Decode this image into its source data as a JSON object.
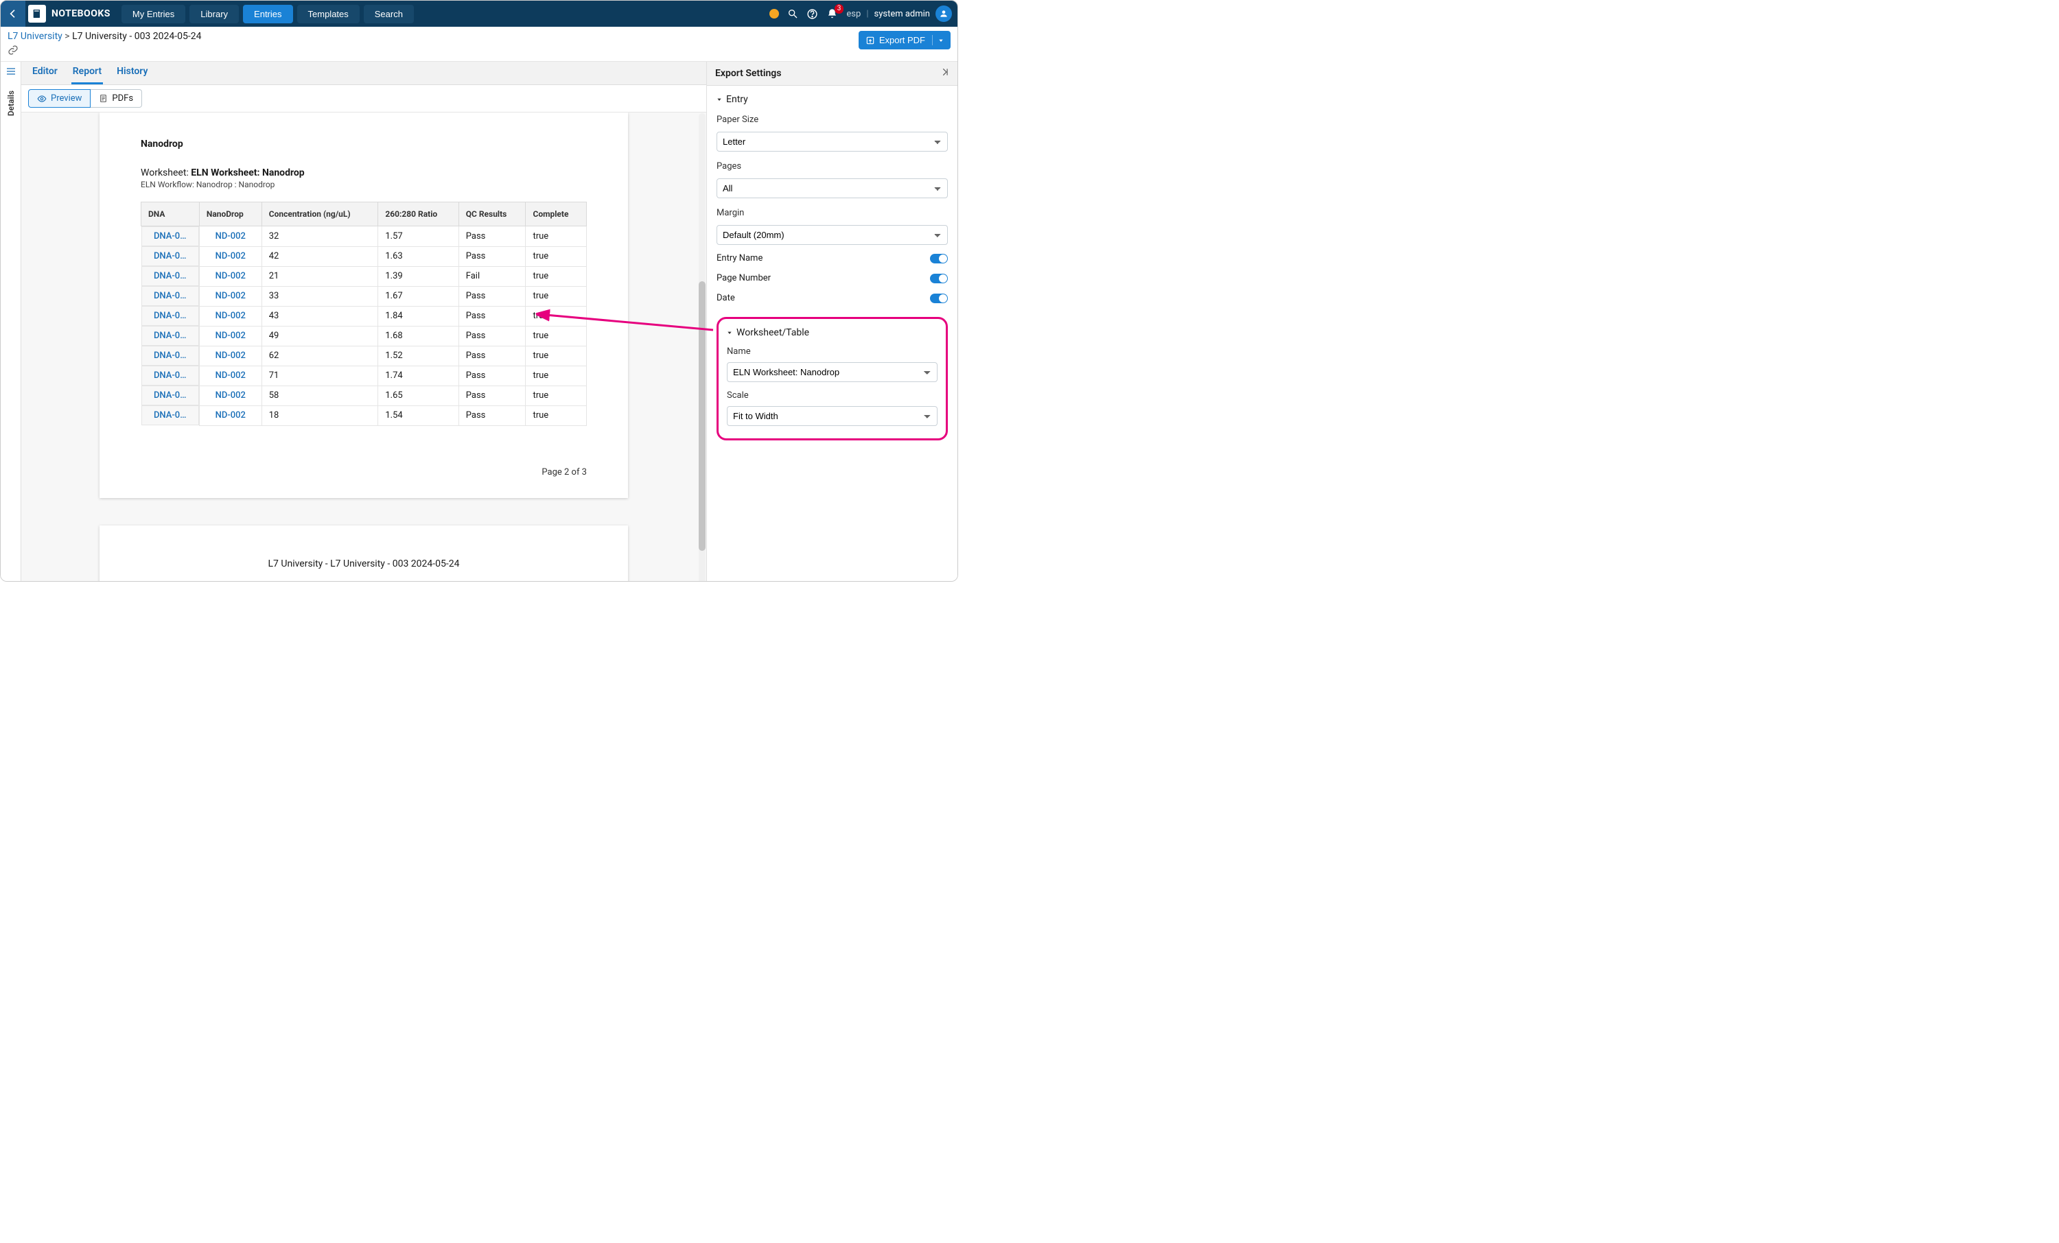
{
  "topbar": {
    "brand": "NOTEBOOKS",
    "nav": [
      "My Entries",
      "Library",
      "Entries",
      "Templates",
      "Search"
    ],
    "active_nav_index": 2,
    "notif_count": "3",
    "esp": "esp",
    "user": "system admin"
  },
  "breadcrumb": {
    "root": "L7 University",
    "sep": ">",
    "current": "L7 University - 003 2024-05-24"
  },
  "export_btn": "Export PDF",
  "rail": {
    "details": "Details"
  },
  "tabs": {
    "editor": "Editor",
    "report": "Report",
    "history": "History"
  },
  "subtabs": {
    "preview": "Preview",
    "pdfs": "PDFs"
  },
  "report": {
    "section_title": "Nanodrop",
    "ws_label": "Worksheet:",
    "ws_name": "ELN Worksheet: Nanodrop",
    "ws_sub": "ELN Workflow: Nanodrop : Nanodrop",
    "headers": [
      "DNA",
      "NanoDrop",
      "Concentration (ng/uL)",
      "260:280 Ratio",
      "QC Results",
      "Complete"
    ],
    "rows": [
      {
        "dna": "DNA-0…",
        "nd": "ND-002",
        "conc": "32",
        "ratio": "1.57",
        "qc": "Pass",
        "complete": "true"
      },
      {
        "dna": "DNA-0…",
        "nd": "ND-002",
        "conc": "42",
        "ratio": "1.63",
        "qc": "Pass",
        "complete": "true"
      },
      {
        "dna": "DNA-0…",
        "nd": "ND-002",
        "conc": "21",
        "ratio": "1.39",
        "qc": "Fail",
        "complete": "true"
      },
      {
        "dna": "DNA-0…",
        "nd": "ND-002",
        "conc": "33",
        "ratio": "1.67",
        "qc": "Pass",
        "complete": "true"
      },
      {
        "dna": "DNA-0…",
        "nd": "ND-002",
        "conc": "43",
        "ratio": "1.84",
        "qc": "Pass",
        "complete": "true"
      },
      {
        "dna": "DNA-0…",
        "nd": "ND-002",
        "conc": "49",
        "ratio": "1.68",
        "qc": "Pass",
        "complete": "true"
      },
      {
        "dna": "DNA-0…",
        "nd": "ND-002",
        "conc": "62",
        "ratio": "1.52",
        "qc": "Pass",
        "complete": "true"
      },
      {
        "dna": "DNA-0…",
        "nd": "ND-002",
        "conc": "71",
        "ratio": "1.74",
        "qc": "Pass",
        "complete": "true"
      },
      {
        "dna": "DNA-0…",
        "nd": "ND-002",
        "conc": "58",
        "ratio": "1.65",
        "qc": "Pass",
        "complete": "true"
      },
      {
        "dna": "DNA-0…",
        "nd": "ND-002",
        "conc": "18",
        "ratio": "1.54",
        "qc": "Pass",
        "complete": "true"
      }
    ],
    "page_indicator": "Page 2 of 3",
    "next_page_title": "L7 University - L7 University - 003 2024-05-24"
  },
  "settings": {
    "header": "Export Settings",
    "entry_section": "Entry",
    "paper_size_label": "Paper Size",
    "paper_size_value": "Letter",
    "pages_label": "Pages",
    "pages_value": "All",
    "margin_label": "Margin",
    "margin_value": "Default (20mm)",
    "entry_name_label": "Entry Name",
    "page_number_label": "Page Number",
    "date_label": "Date",
    "wt_section": "Worksheet/Table",
    "name_label": "Name",
    "name_value": "ELN Worksheet: Nanodrop",
    "scale_label": "Scale",
    "scale_value": "Fit to Width"
  }
}
